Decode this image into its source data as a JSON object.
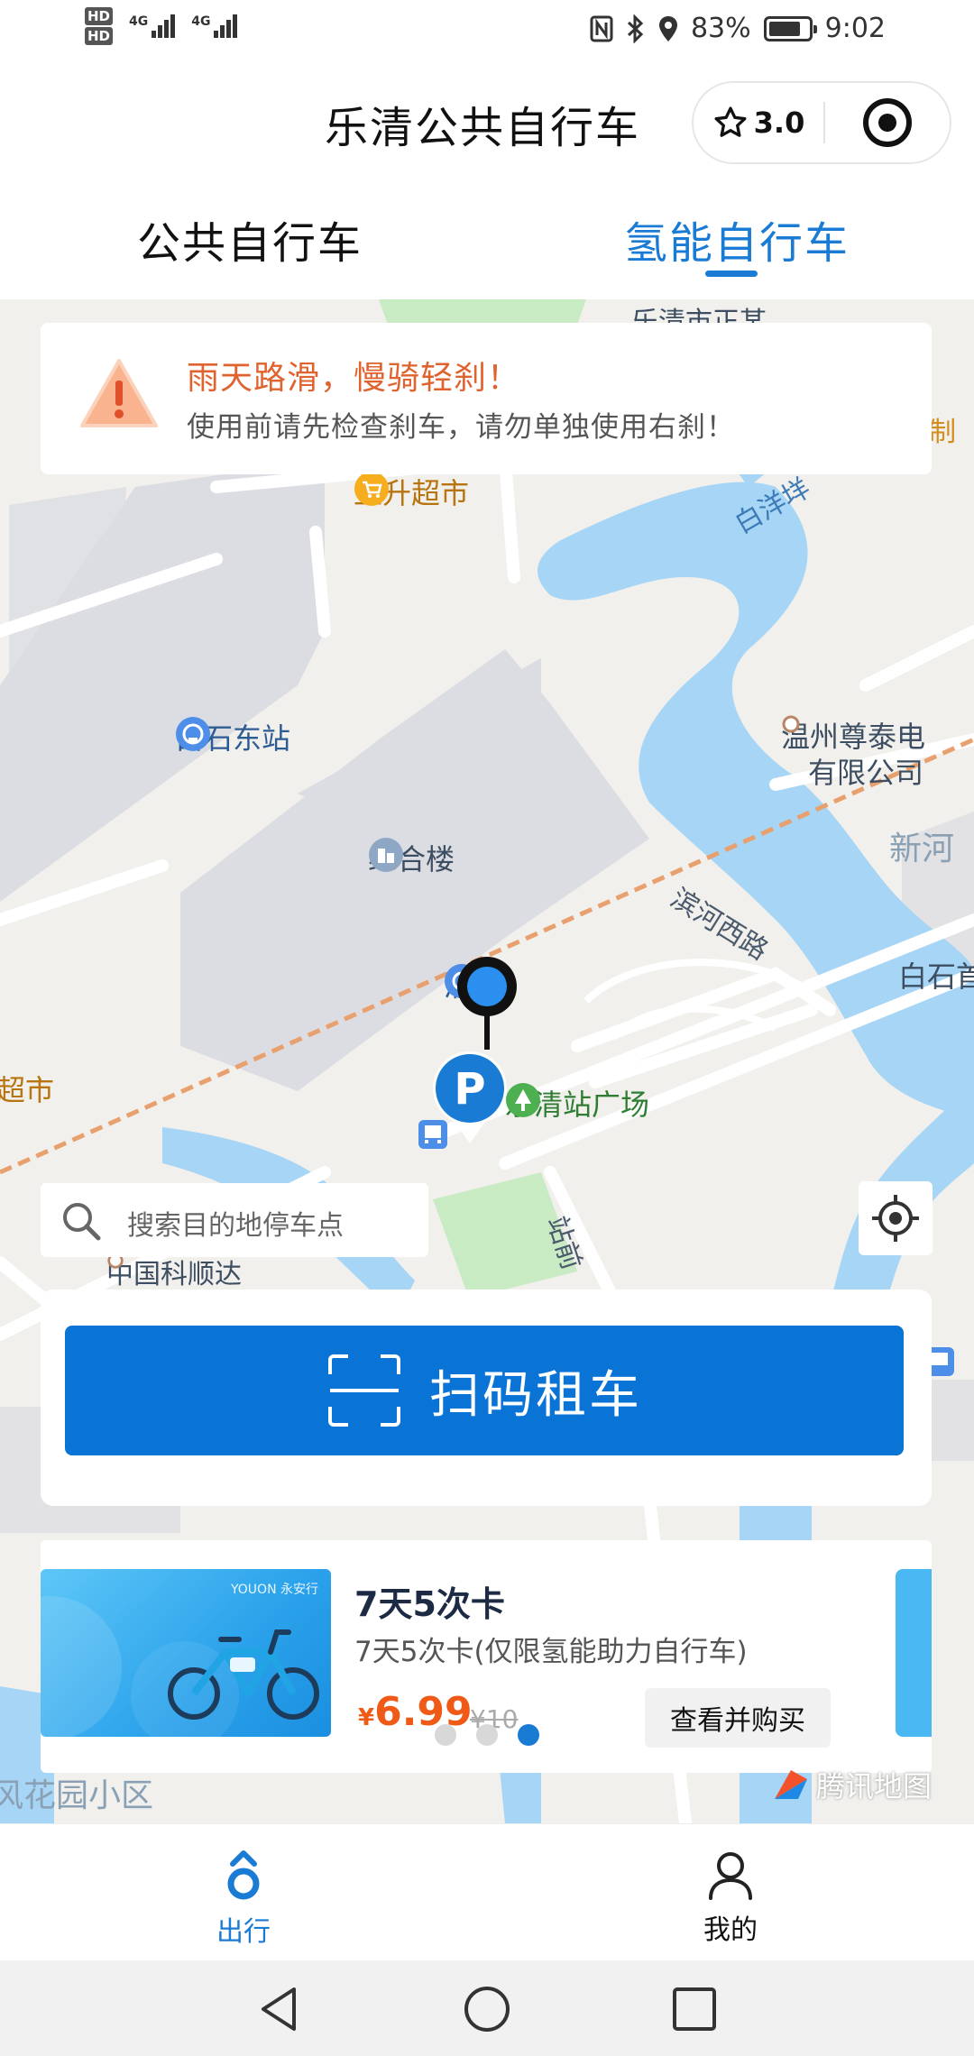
{
  "status_bar": {
    "hd1": "HD",
    "hd2": "HD",
    "net1": "4G",
    "net2": "4G",
    "battery": "83%",
    "battery_level": 0.83,
    "time": "9:02"
  },
  "header": {
    "title": "乐清公共自行车",
    "rating": "3.0"
  },
  "tabs": [
    {
      "label": "公共自行车",
      "active": false
    },
    {
      "label": "氢能自行车",
      "active": true
    }
  ],
  "notice": {
    "title": "雨天路滑，慢骑轻刹！",
    "text": "使用前请先检查刹车，请勿单独使用右刹！"
  },
  "map": {
    "labels": {
      "supermarket": "上升超市",
      "river": "白洋垟",
      "station_east": "白石东站",
      "company": "温州尊泰电",
      "company2": "有限公司",
      "xinhe": "新河",
      "building": "综合楼",
      "road": "滨河西路",
      "qing_station": "清站",
      "baishi": "白石首",
      "market": "超市",
      "plaza": "乐清站广场",
      "zhanqian": "站前",
      "zhongguo": "中国科顺达",
      "garden": "风花园小区",
      "top_street": "乐清市正某",
      "right_edge": "制"
    },
    "colors": {
      "water": "#a6d5f5",
      "ground": "#f1f0ec",
      "block": "#dcdde2",
      "green": "#c9ebc3",
      "rail": "#e8a16e"
    }
  },
  "search": {
    "placeholder": "搜索目的地停车点"
  },
  "scan": {
    "label": "扫码租车"
  },
  "card": {
    "brand": "YOUON 永安行",
    "title": "7天5次卡",
    "desc": "7天5次卡(仅限氢能助力自行车)",
    "currency": "¥",
    "price": "6.99",
    "old_price": "¥10",
    "buy_label": "查看并购买",
    "carousel_index": 3,
    "carousel_total": 3
  },
  "tencent_map": "腾讯地图",
  "bottom_nav": [
    {
      "label": "出行",
      "active": true
    },
    {
      "label": "我的",
      "active": false
    }
  ]
}
